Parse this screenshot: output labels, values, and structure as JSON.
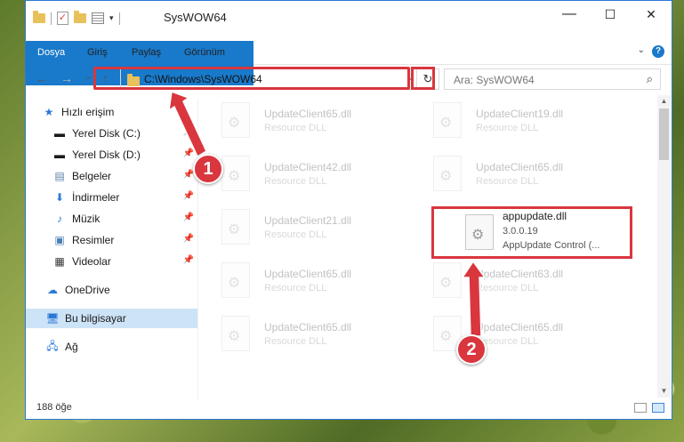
{
  "window": {
    "title": "SysWOW64",
    "controls": {
      "minimize": "—",
      "maximize": "☐",
      "close": "✕"
    }
  },
  "ribbon": {
    "tabs": [
      "Dosya",
      "Giriş",
      "Paylaş",
      "Görünüm"
    ],
    "help": "?"
  },
  "navbar": {
    "back": "←",
    "forward": "→",
    "recent": "⌄",
    "up": "↑",
    "address": "C:\\Windows\\SysWOW64",
    "search_placeholder": "Ara: SysWOW64"
  },
  "sidebar": {
    "items": [
      {
        "label": "Hızlı erişim",
        "icon": "star-icon",
        "pinned": false
      },
      {
        "label": "Yerel Disk (C:)",
        "icon": "drive-icon",
        "pinned": true
      },
      {
        "label": "Yerel Disk (D:)",
        "icon": "drive-icon",
        "pinned": true
      },
      {
        "label": "Belgeler",
        "icon": "documents-icon",
        "pinned": true
      },
      {
        "label": "İndirmeler",
        "icon": "download-icon",
        "pinned": true
      },
      {
        "label": "Müzik",
        "icon": "music-icon",
        "pinned": true
      },
      {
        "label": "Resimler",
        "icon": "pictures-icon",
        "pinned": true
      },
      {
        "label": "Videolar",
        "icon": "videos-icon",
        "pinned": true
      },
      {
        "label": "OneDrive",
        "icon": "cloud-icon",
        "pinned": false
      },
      {
        "label": "Bu bilgisayar",
        "icon": "computer-icon",
        "pinned": false,
        "selected": true
      },
      {
        "label": "Ağ",
        "icon": "network-icon",
        "pinned": false
      }
    ]
  },
  "files": {
    "left": [
      {
        "name": "UpdateClient65.dll",
        "desc": "Resource DLL"
      },
      {
        "name": "UpdateClient42.dll",
        "desc": "Resource DLL"
      },
      {
        "name": "UpdateClient21.dll",
        "desc": "Resource DLL"
      },
      {
        "name": "UpdateClient65.dll",
        "desc": "Resource DLL"
      },
      {
        "name": "UpdateClient65.dll",
        "desc": "Resource DLL"
      }
    ],
    "right": [
      {
        "name": "UpdateClient19.dll",
        "desc": "Resource DLL"
      },
      {
        "name": "UpdateClient65.dll",
        "desc": "Resource DLL"
      },
      {
        "name": "UpdateClient63.dll",
        "desc": "Resource DLL"
      },
      {
        "name": "UpdateClient65.dll",
        "desc": "Resource DLL"
      }
    ],
    "highlighted": {
      "name": "appupdate.dll",
      "version": "3.0.0.19",
      "desc": "AppUpdate Control (..."
    }
  },
  "status": {
    "count": "188 öğe"
  },
  "annotations": {
    "step1": "1",
    "step2": "2",
    "color": "#d9363e"
  }
}
